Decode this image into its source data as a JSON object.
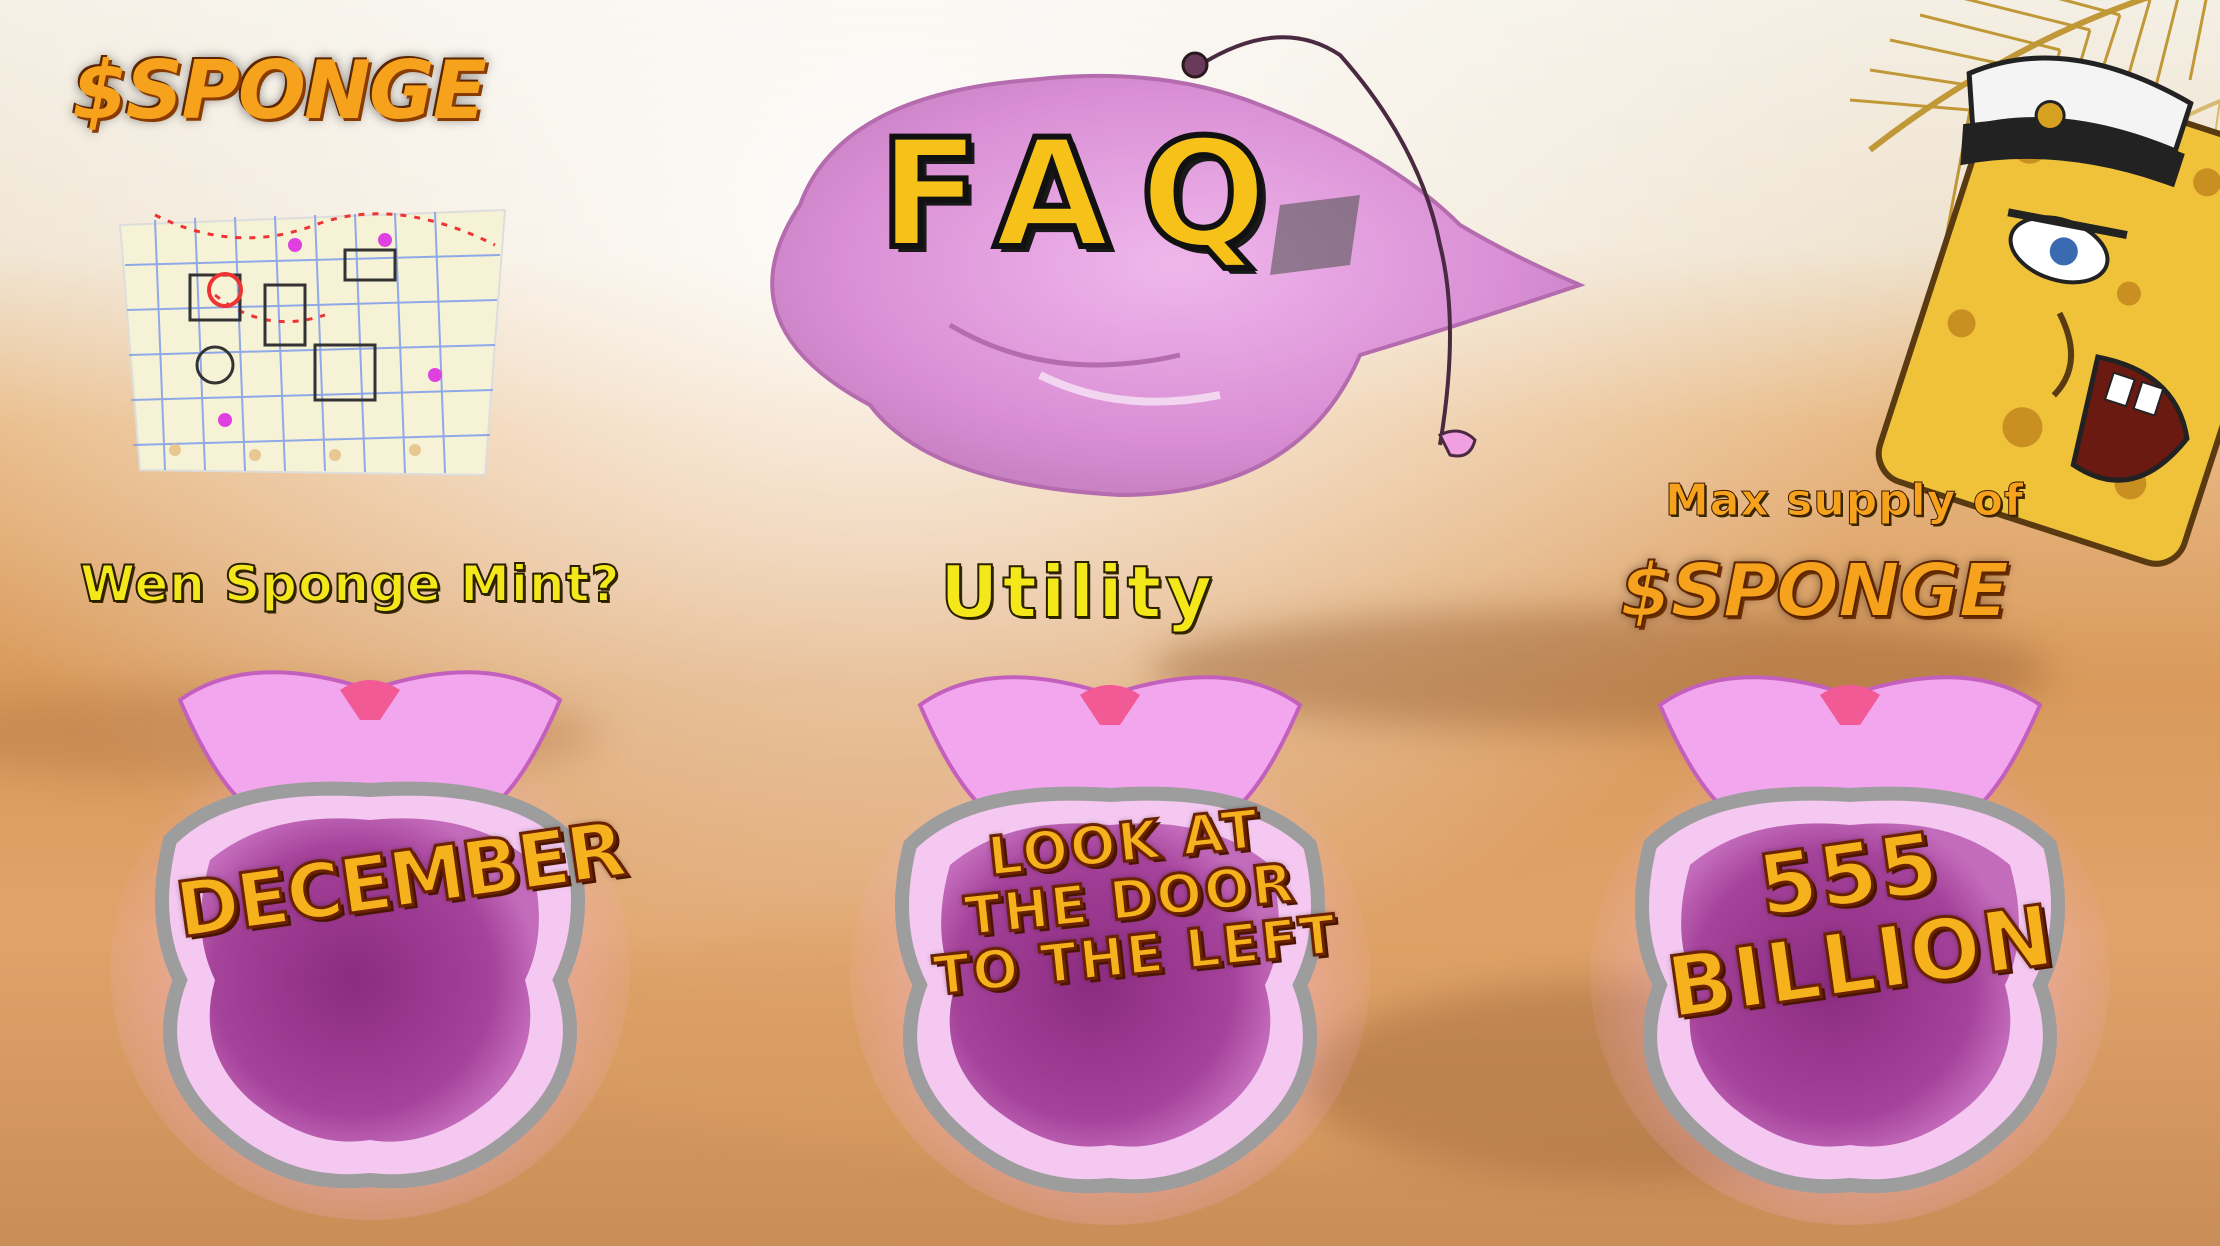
{
  "brand": {
    "logo_text": "$SPONGE"
  },
  "header": {
    "title": "FAQ"
  },
  "faq": [
    {
      "question": "Wen Sponge Mint?",
      "answer": "DECEMBER"
    },
    {
      "question": "Utility",
      "answer": "LOOK AT\nTHE DOOR\nTO THE LEFT"
    },
    {
      "question_line1": "Max supply of",
      "question_line2": "$SPONGE",
      "answer": "555\nBILLION"
    }
  ],
  "icons": {
    "map": "treasure-map-icon",
    "shell": "conch-shell-icon",
    "character": "sponge-captain-icon",
    "palm": "palm-leaf-icon"
  },
  "colors": {
    "accent_orange": "#f6a21c",
    "accent_yellow": "#f4e81a",
    "shell_pink": "#e9a6e4",
    "shell_purple": "#9b3c8f",
    "sand": "#e0a36a"
  }
}
